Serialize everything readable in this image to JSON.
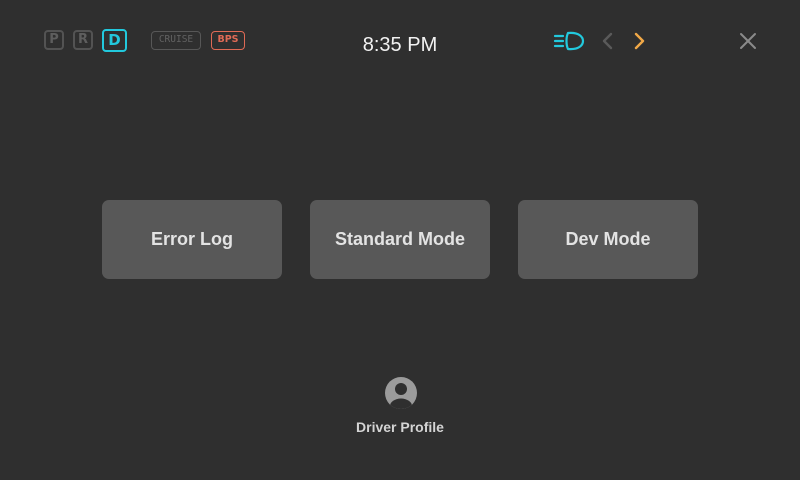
{
  "header": {
    "gears": [
      {
        "label": "P",
        "active": false
      },
      {
        "label": "R",
        "active": false
      },
      {
        "label": "D",
        "active": true
      }
    ],
    "cruise_label": "CRUISE",
    "bps_label": "BPS",
    "clock": "8:35 PM",
    "icons": {
      "headlight": "headlight-icon",
      "prev": "chevron-left-icon",
      "next": "chevron-right-icon",
      "close": "close-icon"
    },
    "colors": {
      "active_gear": "#22c9dd",
      "bps": "#e06a55",
      "headlight": "#22c9dd",
      "next_chevron": "#f0a847",
      "prev_chevron": "#5a5a5a"
    }
  },
  "main": {
    "buttons": [
      {
        "label": "Error Log"
      },
      {
        "label": "Standard Mode"
      },
      {
        "label": "Dev Mode"
      }
    ]
  },
  "profile": {
    "label": "Driver Profile",
    "icon": "account-circle-icon"
  }
}
